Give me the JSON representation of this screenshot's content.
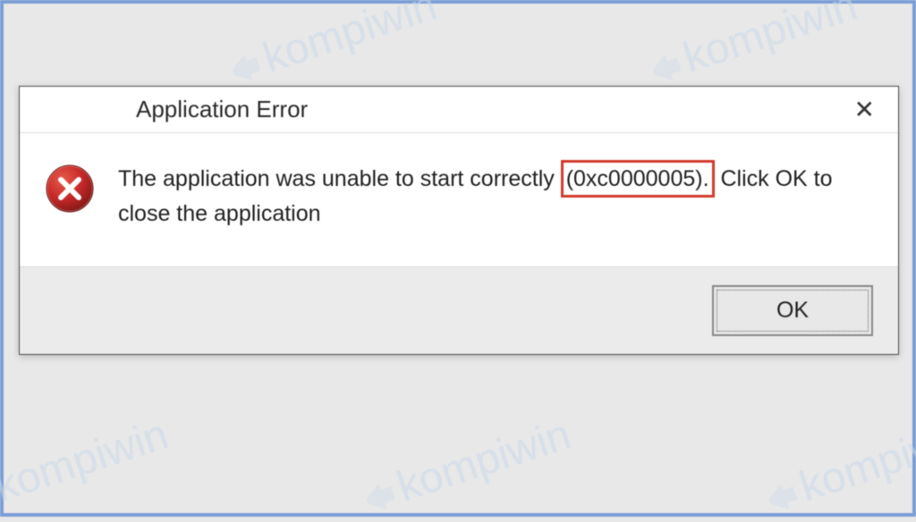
{
  "dialog": {
    "title": "Application Error",
    "message_prefix": "The application was unable to start correctly ",
    "error_code": "(0xc0000005).",
    "message_suffix": " Click OK to close the application",
    "ok_label": "OK"
  },
  "watermark_text": "kompiwin"
}
